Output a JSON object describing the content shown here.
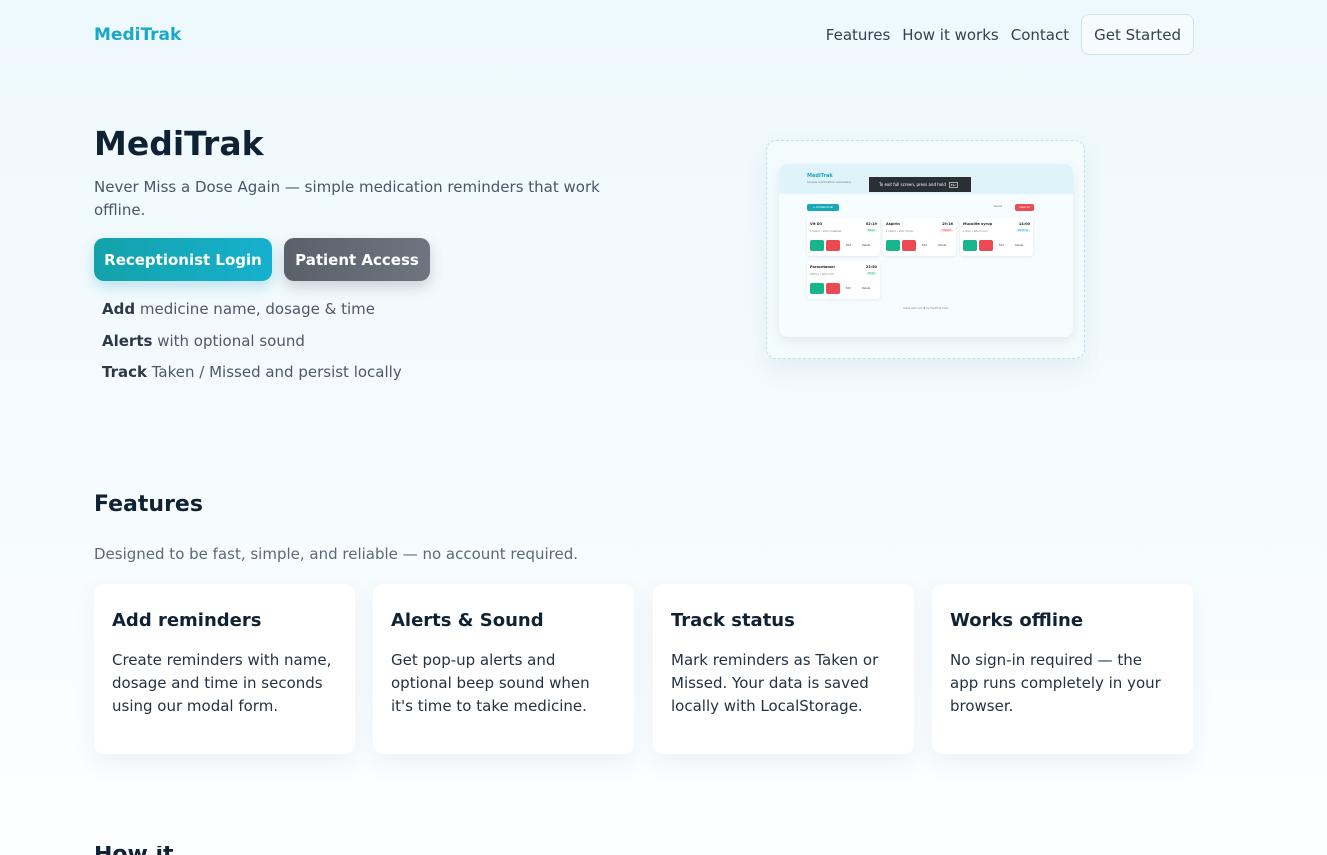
{
  "header": {
    "brand": "MediTrak",
    "nav": [
      "Features",
      "How it works",
      "Contact"
    ],
    "cta": "Get Started"
  },
  "hero": {
    "title": "MediTrak",
    "subtitle": "Never Miss a Dose Again — simple medication reminders that work offline.",
    "primary_button": "Receptionist Login",
    "secondary_button": "Patient Access",
    "bullets": [
      {
        "bold": "Add",
        "text": " medicine name, dosage & time"
      },
      {
        "bold": "Alerts",
        "text": " with optional sound"
      },
      {
        "bold": "Track",
        "text": " Taken / Missed and persist locally"
      }
    ]
  },
  "preview": {
    "brand": "MediTrak",
    "tagline": "Simple medication reminders",
    "toast": "To exit full screen, press and hold",
    "toast_key": "Esc",
    "add_label": "+ Add Reminder",
    "sound_label": "Sound",
    "clear_label": "Clear All",
    "cards": [
      {
        "name": "Vit D3",
        "time": "02:19",
        "dose": "1 tablet • after breakfast",
        "status": "Taken"
      },
      {
        "name": "Aspirin",
        "time": "19:16",
        "dose": "1 tablet • after dinner",
        "status": "Missed"
      },
      {
        "name": "Mucolite syrup",
        "time": "14:00",
        "dose": "1 tbsp • after lunch",
        "status": "Pending"
      },
      {
        "name": "Paracetamol",
        "time": "22:50",
        "dose": "500mg • after food",
        "status": "Taken"
      }
    ],
    "edit_label": "Edit",
    "delete_label": "Delete",
    "footer": "Made with care ♥ by MediTrak team",
    "status_colors": {
      "Taken": "#16b58c",
      "Missed": "#ea4a52",
      "Pending": "#17a9c9"
    }
  },
  "features": {
    "title": "Features",
    "subtitle": "Designed to be fast, simple, and reliable — no account required.",
    "cards": [
      {
        "title": "Add reminders",
        "text": "Create reminders with name, dosage and time in seconds using our modal form."
      },
      {
        "title": "Alerts & Sound",
        "text": "Get pop-up alerts and optional beep sound when it's time to take medicine."
      },
      {
        "title": "Track status",
        "text": "Mark reminders as Taken or Missed. Your data is saved locally with LocalStorage."
      },
      {
        "title": "Works offline",
        "text": "No sign-in required — the app runs completely in your browser."
      }
    ]
  },
  "next_section_title": "How it works",
  "colors": {
    "accent": "#17a9c9",
    "primary_start": "#13a2aa",
    "secondary": "#646b74",
    "heading": "#0e2234"
  }
}
